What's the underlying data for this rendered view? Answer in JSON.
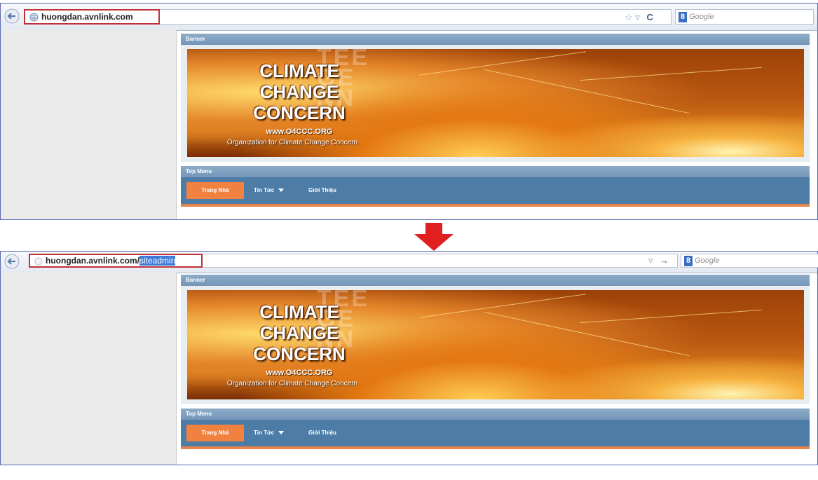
{
  "top": {
    "url": "huongdan.avnlink.com",
    "search_placeholder": "Google",
    "banner_section_label": "Banner",
    "menu_section_label": "Top Menu",
    "banner": {
      "title_line1": "CLIMATE",
      "title_line2": "CHANGE",
      "title_line3": "CONCERN",
      "website": "www.O4CCC.ORG",
      "org_name": "Organization for Climate Change Concern",
      "ghost_text": "TEE\nGE\nNN"
    },
    "menu": {
      "home": "Trang Nhà",
      "news": "Tin Tức",
      "about": "Giới Thiệu"
    }
  },
  "bottom": {
    "url_base": "huongdan.avnlink.com/",
    "url_selected": "siteadmin",
    "search_placeholder": "Google",
    "banner_section_label": "Banner",
    "menu_section_label": "Top Menu",
    "banner": {
      "title_line1": "CLIMATE",
      "title_line2": "CHANGE",
      "title_line3": "CONCERN",
      "website": "www.O4CCC.ORG",
      "org_name": "Organization for Climate Change Concern",
      "ghost_text": "TEE\nGE\nNN"
    },
    "menu": {
      "home": "Trang Nhà",
      "news": "Tin Tức",
      "about": "Giới Thiệu"
    }
  },
  "colors": {
    "highlight_box": "#c0303a",
    "section_header": "#7f9fc0",
    "menu_bar": "#4d7ca6",
    "menu_active": "#f1813f",
    "arrow": "#e02020"
  },
  "icons": [
    "back-arrow-icon",
    "globe-icon",
    "bookmark-star-icon",
    "dropdown-icon",
    "refresh-icon",
    "forward-arrow-icon",
    "google-search-icon",
    "down-arrow-icon"
  ]
}
